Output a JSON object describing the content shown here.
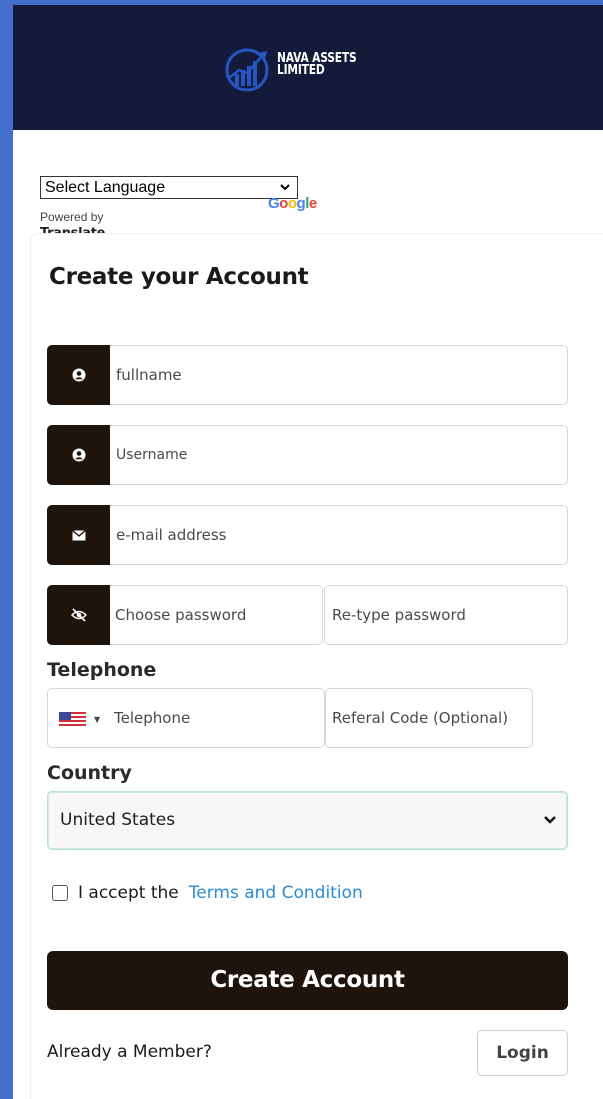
{
  "brand": {
    "line1": "NAVA ASSETS",
    "line2": "LIMITED",
    "header_bg": "#141a3a",
    "logo_color": "#2457c5"
  },
  "translate_widget": {
    "select_value": "Select Language",
    "powered_by": "Powered by",
    "google_letters": [
      "G",
      "o",
      "o",
      "g",
      "l",
      "e"
    ],
    "translate_label": "Translate"
  },
  "form": {
    "title": "Create your Account",
    "fullname_placeholder": "fullname",
    "username_placeholder": "Username",
    "email_placeholder": "e-mail address",
    "password_placeholder": "Choose password",
    "retype_placeholder": "Re-type password",
    "telephone_label": "Telephone",
    "telephone_placeholder": "Telephone",
    "referral_placeholder": "Referal Code (Optional)",
    "country_label": "Country",
    "country_value": "United States",
    "terms_prefix": "I accept the",
    "terms_link": "Terms and Condition",
    "submit_label": "Create Account",
    "member_text": "Already a Member?",
    "login_label": "Login"
  },
  "colors": {
    "accent_dark": "#1f140c",
    "link": "#2a8bd8",
    "frame": "#4470cc"
  },
  "icons": {
    "fullname": "user-circle-icon",
    "username": "user-circle-icon",
    "email": "envelope-icon",
    "password": "eye-slash-icon",
    "flag": "us-flag-icon",
    "country": "chevron-down-icon"
  }
}
